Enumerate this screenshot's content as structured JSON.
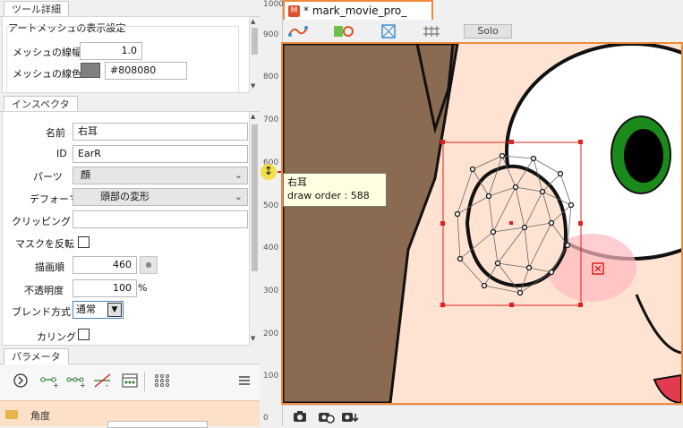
{
  "tool_detail": {
    "header": "ツール詳細",
    "group_title": "アートメッシュの表示設定",
    "line_width_label": "メッシュの線幅",
    "line_width_value": "1.0",
    "line_color_label": "メッシュの線色",
    "line_color_value": "#808080",
    "line_color_swatch": "#808080"
  },
  "inspector": {
    "header": "インスペクタ",
    "name_label": "名前",
    "name_value": "右耳",
    "id_label": "ID",
    "id_value": "EarR",
    "parts_label": "パーツ",
    "parts_value": "顔",
    "deformer_label": "デフォーマ",
    "deformer_value": "頭部の変形",
    "clipping_label": "クリッピング",
    "clipping_value": "",
    "invert_mask_label": "マスクを反転",
    "draw_order_label": "描画順",
    "draw_order_value": "460",
    "opacity_label": "不透明度",
    "opacity_value": "100",
    "opacity_unit": "%",
    "blend_label": "ブレンド方式",
    "blend_value": "通常",
    "culling_label": "カリング"
  },
  "parameter": {
    "header": "パラメータ",
    "first_row": "角度"
  },
  "ruler": {
    "ticks": [
      "1000",
      "900",
      "800",
      "700",
      "600",
      "500",
      "400",
      "300",
      "200",
      "100",
      "0"
    ]
  },
  "document": {
    "tab_title": "* mark_movie_pro_",
    "solo_label": "Solo"
  },
  "tooltip": {
    "name": "右耳",
    "draw_order": "draw order : 588"
  },
  "colors": {
    "accent": "#f08a3a",
    "selection": "#e02020",
    "hair": "#8b6a52",
    "skin": "#ffe3d2",
    "eye_green": "#1a8a1a"
  }
}
